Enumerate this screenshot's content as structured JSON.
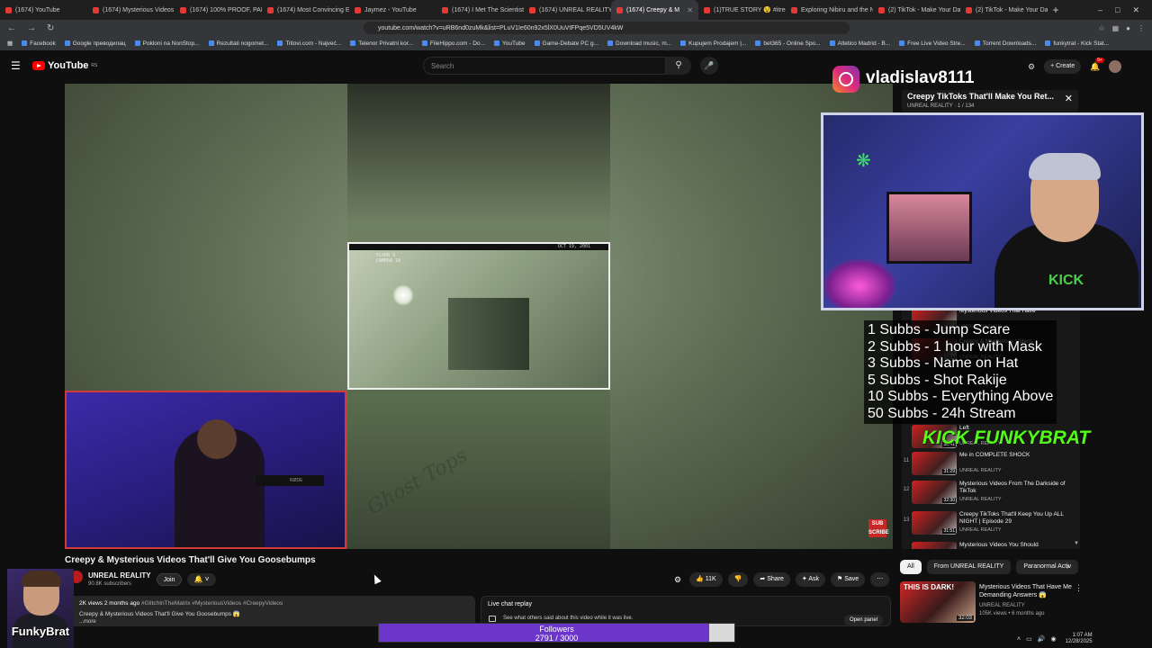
{
  "browser": {
    "tabs": [
      {
        "label": "(1674) YouTube",
        "active": false
      },
      {
        "label": "(1674) Mysterious Videos N",
        "active": false
      },
      {
        "label": "(1674) 100% PROOF, PARA",
        "active": false
      },
      {
        "label": "(1674) Most Convincing Evi",
        "active": false
      },
      {
        "label": "Jaymez - YouTube",
        "active": false
      },
      {
        "label": "(1674) I Met The Scientist T",
        "active": false
      },
      {
        "label": "(1674) UNREAL REALITY - Y",
        "active": false
      },
      {
        "label": "(1674) Creepy & M",
        "active": true
      },
      {
        "label": "(1)TRUE STORY 😵 #itreere",
        "active": false
      },
      {
        "label": "Exploring Nibiru and the N",
        "active": false
      },
      {
        "label": "(2) TikTok - Make Your Day",
        "active": false
      },
      {
        "label": "(2) TikTok - Make Your Day",
        "active": false
      }
    ],
    "url": "youtube.com/watch?v=uRB6nd0zuMk&list=PLuV1Ie60n92x5lX0UuVtFPqe5VD5UV4kW",
    "bookmarks": [
      "Facebook",
      "Google преводилац",
      "Pokloni na NonStop...",
      "Rezultati nogomet...",
      "Titlovi.com - Najveć...",
      "Telenor Privatni kor...",
      "FileHippo.com - Do...",
      "YouTube",
      "Game-Debate PC g...",
      "Download music, m...",
      "Kupujem Prodajem |...",
      "bet365 - Online Spo...",
      "Atletico Madrid - B...",
      "Free Live Video Stre...",
      "Torrent Downloads...",
      "funkytrat - Kick Stat..."
    ]
  },
  "youtube": {
    "logo": "YouTube",
    "logo_region": "RS",
    "search_placeholder": "Search",
    "create_label": "Create",
    "notification_count": "9+"
  },
  "video": {
    "title": "Creepy & Mysterious Videos That'll Give You Goosebumps",
    "channel": "UNREAL REALITY",
    "subscribers": "90.8K subscribers",
    "join_label": "Join",
    "likes": "11K",
    "share_label": "Share",
    "ask_label": "Ask",
    "save_label": "Save",
    "cctv_label": "FLOOR 3\nCAMERA 18",
    "cctv_stamp": "OCT 19, 2001",
    "watermark": "Ghost Tops",
    "mic_brand": "RØDE",
    "sub_logo": "SUB SCRIBE"
  },
  "description": {
    "meta": "2K views  2 months ago",
    "tags": "#GlitchInTheMatrix #MysteriousVideos #CreepyVideos",
    "text": "Creepy & Mysterious Videos That'll Give You Goosebumps 😱",
    "more": "...more"
  },
  "live_chat": {
    "title": "Live chat replay",
    "subtitle": "See what others said about this video while it was live.",
    "button": "Open panel"
  },
  "overlay": {
    "instagram_handle": "vladislav8111",
    "miniplayer_title": "Creepy TikToks That'll Make You Ret...",
    "miniplayer_sub": "UNREAL REALITY · 1 / 134",
    "shirt_text": "KICK",
    "goals": [
      "1 Subbs - Jump Scare",
      "2 Subbs - 1 hour with Mask",
      "3 Subbs - Name on Hat",
      "5 Subbs - Shot Rakije",
      "10 Subbs - Everything Above",
      "50 Subbs - 24h Stream"
    ],
    "kick_banner": "KICK FUNKYBRAT",
    "streamer_name": "FunkyBrat"
  },
  "playlist": {
    "items": [
      {
        "num": "",
        "title": "Mysterious Videos That Have",
        "channel": "UNREAL REALITY",
        "duration": "31:05"
      },
      {
        "num": "",
        "title": "Creepy & Mysterious Videos",
        "channel": "UNREAL REALITY",
        "duration": "32:03"
      },
      {
        "num": "",
        "title": "Left",
        "channel": "UNREAL REALITY",
        "duration": "30:41"
      },
      {
        "num": "11",
        "title": "Me in COMPLETE SHOCK",
        "channel": "UNREAL REALITY",
        "duration": "31:29"
      },
      {
        "num": "12",
        "title": "Mysterious Videos From The Darkside of TikTok",
        "channel": "UNREAL REALITY",
        "duration": "32:30"
      },
      {
        "num": "13",
        "title": "Creepy TikToks That'll Keep You Up ALL NIGHT | Episode 29",
        "channel": "UNREAL REALITY",
        "duration": "31:51"
      },
      {
        "num": "",
        "title": "Mysterious Videos You Should",
        "channel": "",
        "duration": ""
      }
    ]
  },
  "chips": [
    "All",
    "From UNREAL REALITY",
    "Paranormal Activ"
  ],
  "recommendation": {
    "caption": "THIS IS DARK!",
    "title": "Mysterious Videos That Have Me Demanding Answers 😱",
    "channel": "UNREAL REALITY",
    "meta": "105K views • 6 months ago",
    "duration": "32:03"
  },
  "followers_goal": {
    "label": "Followers",
    "count": "2791 / 3000",
    "current": 2791,
    "target": 3000
  },
  "tray": {
    "time": "1:07 AM",
    "date": "12/28/2025"
  },
  "colors": {
    "yt_red": "#ff0000",
    "kick_green": "#53fc18",
    "followers_purple": "#6b36c9"
  }
}
